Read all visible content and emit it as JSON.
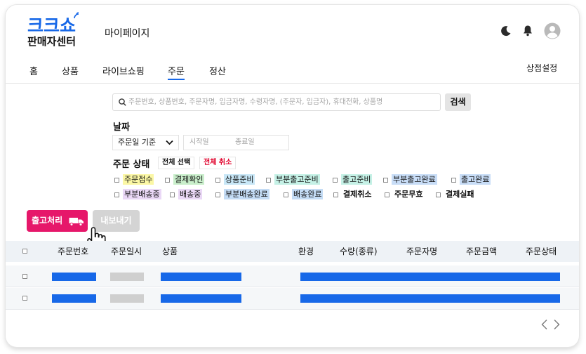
{
  "brand": {
    "logo_top": "크크쇼",
    "logo_bottom": "판매자센터"
  },
  "header": {
    "mypage": "마이페이지"
  },
  "nav": {
    "items": [
      "홈",
      "상품",
      "라이브쇼핑",
      "주문",
      "정산"
    ],
    "active": "주문",
    "store_settings": "상점설정"
  },
  "search": {
    "placeholder": "주문번호, 상품번호, 주문자명, 입금자명, 수령자명, (주문자, 입금자), 휴대전화, 상품명",
    "button": "검색"
  },
  "date": {
    "label": "날짜",
    "select_value": "주문일 기준",
    "start_placeholder": "시작일",
    "end_placeholder": "종료일"
  },
  "order_status": {
    "label": "주문 상태",
    "select_all": "전체 선택",
    "deselect_all": "전체 취소",
    "row1": [
      {
        "label": "주문접수",
        "color": "#fbf7a5"
      },
      {
        "label": "결제확인",
        "color": "#c9eecb"
      },
      {
        "label": "상품준비",
        "color": "#c8e7f7"
      },
      {
        "label": "부분출고준비",
        "color": "#c5f1e6"
      },
      {
        "label": "출고준비",
        "color": "#c5f1e6"
      },
      {
        "label": "부분출고완료",
        "color": "#c8ddf7"
      },
      {
        "label": "출고완료",
        "color": "#c8ddf7"
      }
    ],
    "row2": [
      {
        "label": "부분배송중",
        "color": "#ead8f6"
      },
      {
        "label": "배송중",
        "color": "#ead8f6"
      },
      {
        "label": "부분배송완료",
        "color": "#c4dcf5"
      },
      {
        "label": "배송완료",
        "color": "#c4dcf5"
      },
      {
        "label": "결제취소",
        "color": "#ffffff"
      },
      {
        "label": "주문무효",
        "color": "#ffffff"
      },
      {
        "label": "결제실패",
        "color": "#ffffff"
      }
    ]
  },
  "actions": {
    "ship": "출고처리",
    "export": "내보내기"
  },
  "table": {
    "columns": [
      "주문번호",
      "주문일시",
      "상품",
      "환경",
      "수량(종류)",
      "주문자명",
      "주문금액",
      "주문상태"
    ]
  },
  "colors": {
    "accent": "#1768e8",
    "primary_action": "#e6176a"
  }
}
